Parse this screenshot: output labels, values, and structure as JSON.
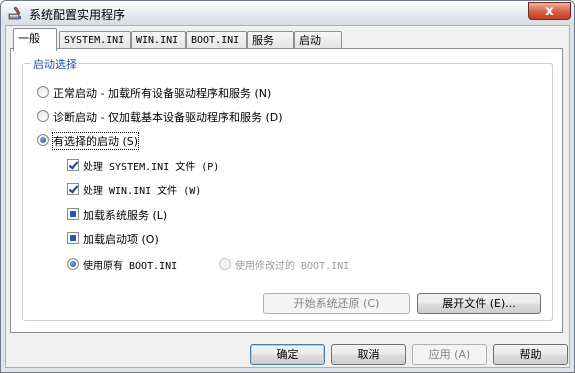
{
  "window": {
    "title": "系统配置实用程序",
    "close_glyph": "x"
  },
  "tabs": [
    {
      "label": "一般",
      "active": true
    },
    {
      "label": "SYSTEM.INI"
    },
    {
      "label": "WIN.INI"
    },
    {
      "label": "BOOT.INI"
    },
    {
      "label": "服务"
    },
    {
      "label": "启动"
    }
  ],
  "group": {
    "label": "启动选择"
  },
  "startup": {
    "normal": "正常启动 - 加载所有设备驱动程序和服务 (N)",
    "diagnostic": "诊断启动 - 仅加载基本设备驱动程序和服务 (D)",
    "selective": "有选择的启动 (S)",
    "selected": "selective"
  },
  "options": {
    "system_ini": {
      "label": "处理 SYSTEM.INI 文件 (P)",
      "checked": true
    },
    "win_ini": {
      "label": "处理 WIN.INI 文件 (W)",
      "checked": true
    },
    "services": {
      "label": "加载系统服务 (L)",
      "state": "indeterminate"
    },
    "startup_items": {
      "label": "加载启动项 (O)",
      "state": "indeterminate"
    }
  },
  "boot": {
    "original": "使用原有 BOOT.INI",
    "modified": "使用修改过的 BOOT.INI",
    "selected": "original"
  },
  "buttons": {
    "restore": "开始系统还原 (C)",
    "expand": "展开文件 (E)...",
    "ok": "确定",
    "cancel": "取消",
    "apply": "应用 (A)",
    "help": "帮助"
  },
  "colors": {
    "accent": "#1f4fa0",
    "close": "#c23c22"
  }
}
